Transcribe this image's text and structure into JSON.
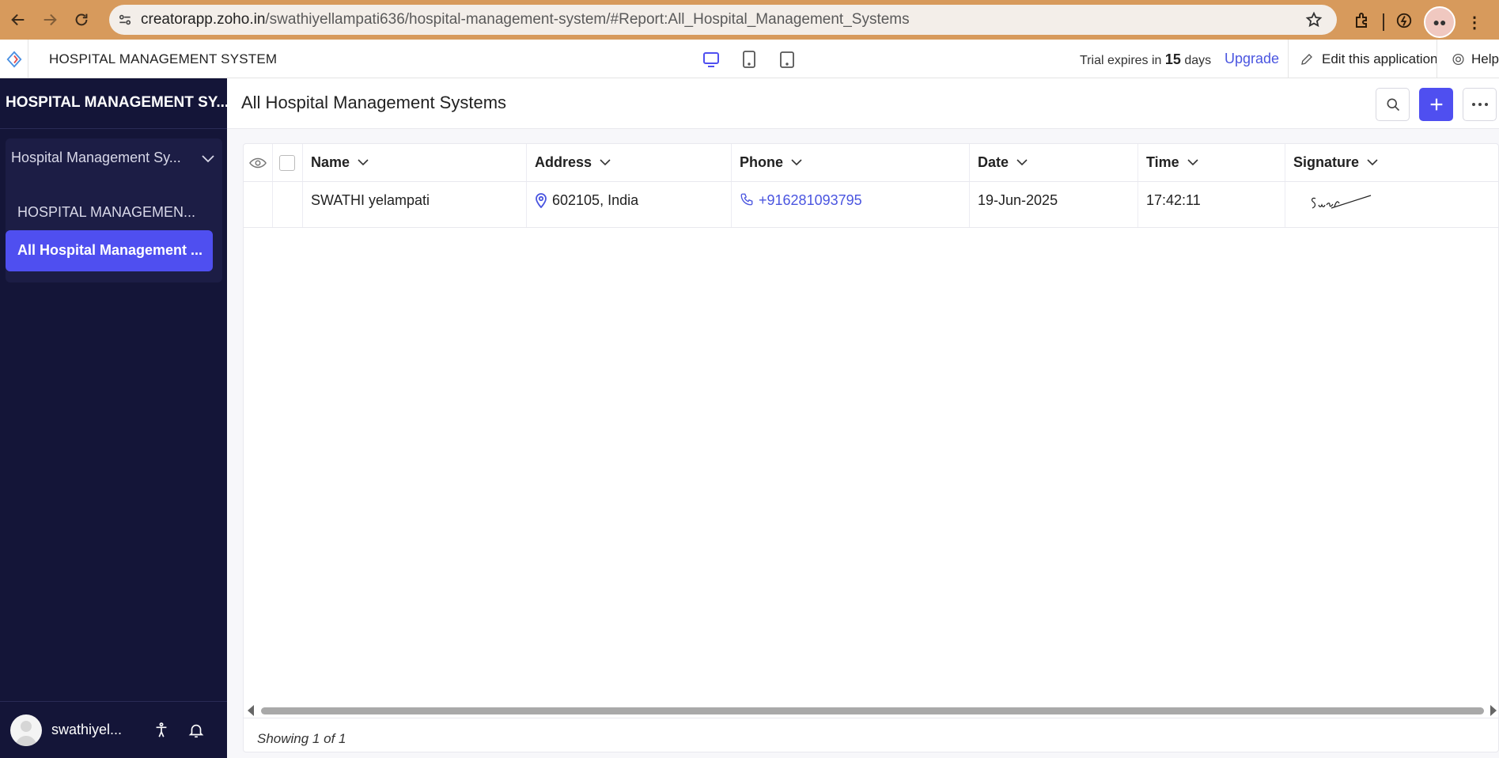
{
  "browser": {
    "url_host": "creatorapp.zoho.in",
    "url_path": "/swathiyellampati636/hospital-management-system/#Report:All_Hospital_Management_Systems"
  },
  "header": {
    "app_title": "HOSPITAL MANAGEMENT SYSTEM",
    "trial_prefix": "Trial expires in",
    "trial_days": "15",
    "trial_suffix": "days",
    "upgrade_label": "Upgrade",
    "edit_label": "Edit this application",
    "help_label": "Help"
  },
  "sidebar": {
    "title": "HOSPITAL MANAGEMENT SY...",
    "group_label": "Hospital Management Sy...",
    "items": [
      {
        "label": "HOSPITAL MANAGEMEN..."
      },
      {
        "label": "All Hospital Management ..."
      }
    ],
    "user_name": "swathiyel..."
  },
  "main": {
    "page_title": "All Hospital Management Systems",
    "columns": [
      "Name",
      "Address",
      "Phone",
      "Date",
      "Time",
      "Signature"
    ],
    "rows": [
      {
        "name": "SWATHI yelampati",
        "address": "602105, India",
        "phone": "+916281093795",
        "date": "19-Jun-2025",
        "time": "17:42:11",
        "signature": "Swathi"
      }
    ],
    "showing": "Showing 1 of 1"
  },
  "colors": {
    "accent": "#4f4ff0",
    "sidebar_bg": "#141538",
    "browser_bar": "#d79a5c",
    "link": "#4a55e0"
  },
  "icons": [
    "back-icon",
    "forward-icon",
    "reload-icon",
    "site-settings-icon",
    "star-icon",
    "extensions-icon",
    "performance-icon",
    "profile-icon",
    "menu-icon",
    "app-logo-icon",
    "desktop-icon",
    "tablet-icon",
    "mobile-icon",
    "pencil-icon",
    "help-icon",
    "chevron-down-icon",
    "eye-icon",
    "checkbox-icon",
    "location-pin-icon",
    "phone-icon",
    "search-icon",
    "plus-icon",
    "more-icon",
    "accessibility-icon",
    "bell-icon",
    "avatar-icon"
  ]
}
